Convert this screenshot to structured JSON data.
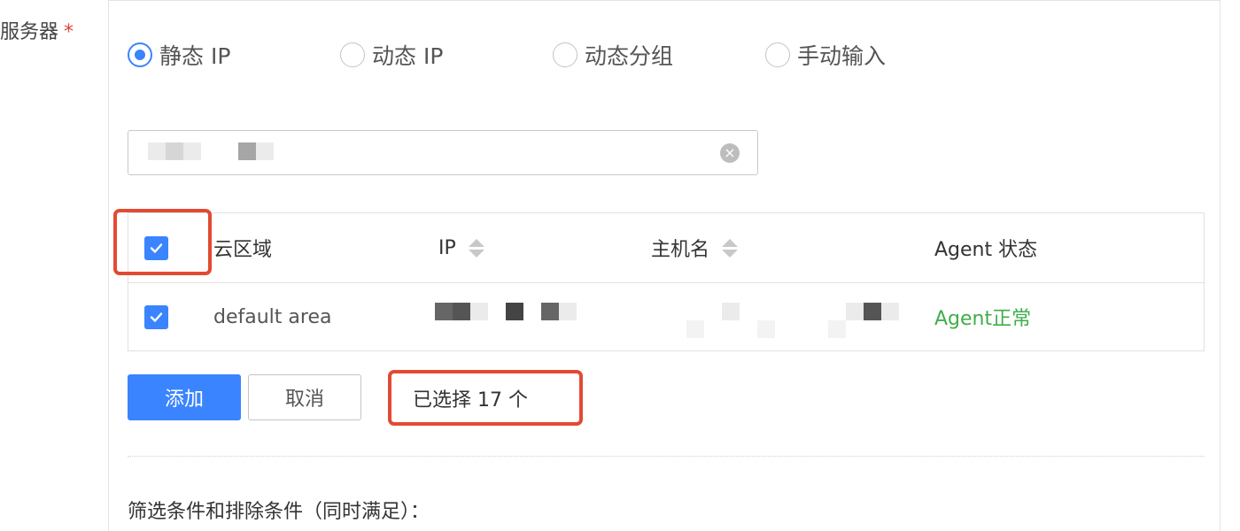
{
  "form": {
    "label": "服务器",
    "required_mark": "*"
  },
  "target_type": {
    "options": [
      {
        "label": "静态 IP",
        "checked": true
      },
      {
        "label": "动态 IP",
        "checked": false
      },
      {
        "label": "动态分组",
        "checked": false
      },
      {
        "label": "手动输入",
        "checked": false
      }
    ]
  },
  "search": {
    "clear_icon": "close-circle-icon"
  },
  "table": {
    "headers": {
      "cloud_area": "云区域",
      "ip": "IP",
      "hostname": "主机名",
      "agent_status": "Agent 状态"
    },
    "rows": [
      {
        "checked": true,
        "cloud_area": "default area",
        "agent_status": "Agent正常"
      }
    ]
  },
  "actions": {
    "add_label": "添加",
    "cancel_label": "取消",
    "selected_text": "已选择 17 个"
  },
  "filter": {
    "label": "筛选条件和排除条件（同时满足）："
  },
  "colors": {
    "primary": "#3a84ff",
    "status_ok": "#3fae49",
    "highlight": "#e24a33",
    "required": "#e0403a"
  }
}
